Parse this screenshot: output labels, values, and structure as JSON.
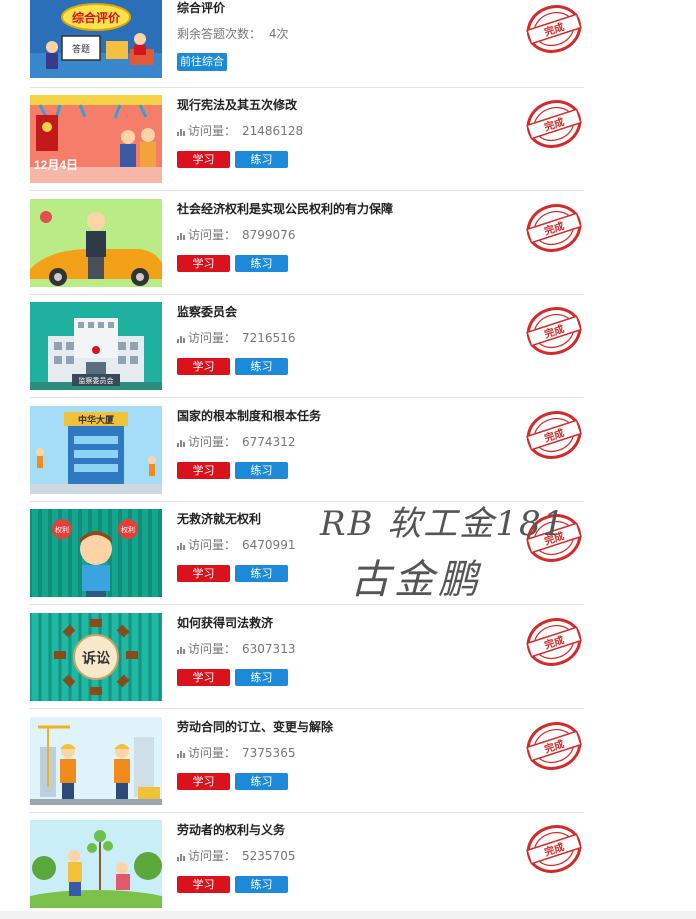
{
  "summary": {
    "title": "综合评价",
    "remaining_label": "剩余答题次数：",
    "remaining_value": "4次",
    "goto_button": "前往综合",
    "thumb_badge": "综合评价",
    "thumb_board": "答题",
    "stamp_text": "完成"
  },
  "course_common": {
    "visits_label": "访问量：",
    "learn_label": "学习",
    "practice_label": "练习",
    "stamp_text": "完成"
  },
  "courses": [
    {
      "title": "现行宪法及其五次修改",
      "visits": "21486128",
      "thumb_text": "12月4日",
      "thumb_icon": "constitution-book"
    },
    {
      "title": "社会经济权利是实现公民权利的有力保障",
      "visits": "8799076",
      "thumb_text": "",
      "thumb_icon": "man-with-car"
    },
    {
      "title": "监察委员会",
      "visits": "7216516",
      "thumb_text": "监察委员会",
      "thumb_icon": "government-building"
    },
    {
      "title": "国家的根本制度和根本任务",
      "visits": "6774312",
      "thumb_text": "中华大厦",
      "thumb_icon": "building-under-construction"
    },
    {
      "title": "无救济就无权利",
      "visits": "6470991",
      "thumb_text": "权利",
      "thumb_icon": "boy-with-balloons"
    },
    {
      "title": "如何获得司法救济",
      "visits": "6307313",
      "thumb_text": "诉讼",
      "thumb_icon": "gavels-circle"
    },
    {
      "title": "劳动合同的订立、变更与解除",
      "visits": "7375365",
      "thumb_text": "",
      "thumb_icon": "construction-workers"
    },
    {
      "title": "劳动者的权利与义务",
      "visits": "5235705",
      "thumb_text": "",
      "thumb_icon": "people-planting-tree"
    }
  ],
  "handwriting": {
    "line1": "RB 软工金181",
    "line2": "古金鹏"
  },
  "colors": {
    "learn": "#d9121b",
    "practice": "#1c8ad9",
    "stamp": "#d42a2a"
  }
}
